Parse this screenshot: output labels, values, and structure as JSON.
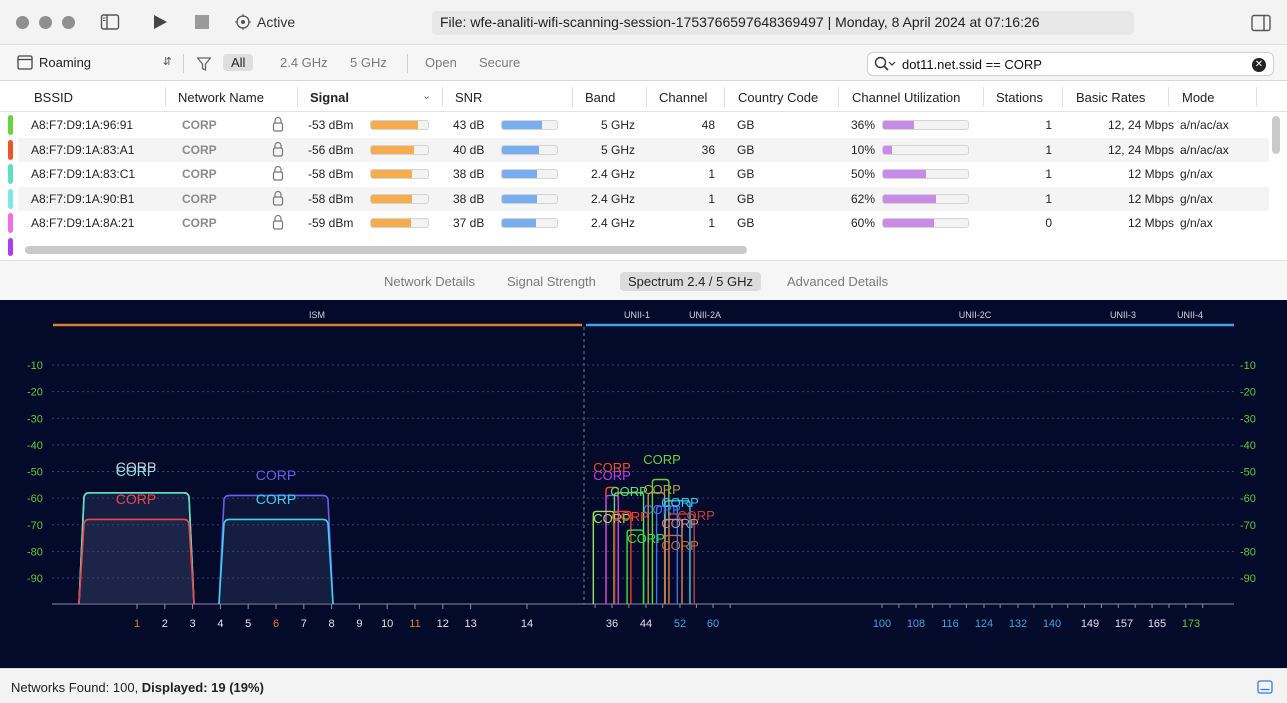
{
  "titlebar": {
    "active_label": "Active",
    "file_label": "File: wfe-analiti-wifi-scanning-session-1753766597648369497 | Monday, 8 April 2024 at 07:16:26"
  },
  "toolbar": {
    "mode_select": "Roaming",
    "filters": [
      "All",
      "2.4 GHz",
      "5 GHz",
      "Open",
      "Secure"
    ],
    "search_value": "dot11.net.ssid == CORP"
  },
  "table": {
    "headers": [
      "BSSID",
      "Network Name",
      "Signal",
      "SNR",
      "Band",
      "Channel",
      "Country Code",
      "Channel Utilization",
      "Stations",
      "Basic Rates",
      "Mode"
    ],
    "rows": [
      {
        "tag": "#6ad23a",
        "bssid": "A8:F7:D9:1A:96:91",
        "name": "CORP",
        "signal": "-53 dBm",
        "signal_frac": 0.82,
        "snr": "43 dB",
        "snr_frac": 0.72,
        "band": "5 GHz",
        "channel": "48",
        "country": "GB",
        "util": "36%",
        "util_frac": 0.36,
        "stations": "1",
        "rates": "12, 24 Mbps",
        "mode": "a/n/ac/ax"
      },
      {
        "tag": "#f0522a",
        "bssid": "A8:F7:D9:1A:83:A1",
        "name": "CORP",
        "signal": "-56 dBm",
        "signal_frac": 0.75,
        "snr": "40 dB",
        "snr_frac": 0.68,
        "band": "5 GHz",
        "channel": "36",
        "country": "GB",
        "util": "10%",
        "util_frac": 0.1,
        "stations": "1",
        "rates": "12, 24 Mbps",
        "mode": "a/n/ac/ax"
      },
      {
        "tag": "#5de0c0",
        "bssid": "A8:F7:D9:1A:83:C1",
        "name": "CORP",
        "signal": "-58 dBm",
        "signal_frac": 0.72,
        "snr": "38 dB",
        "snr_frac": 0.64,
        "band": "2.4 GHz",
        "channel": "1",
        "country": "GB",
        "util": "50%",
        "util_frac": 0.5,
        "stations": "1",
        "rates": "12 Mbps",
        "mode": "g/n/ax"
      },
      {
        "tag": "#7de8e0",
        "bssid": "A8:F7:D9:1A:90:B1",
        "name": "CORP",
        "signal": "-58 dBm",
        "signal_frac": 0.72,
        "snr": "38 dB",
        "snr_frac": 0.64,
        "band": "2.4 GHz",
        "channel": "1",
        "country": "GB",
        "util": "62%",
        "util_frac": 0.62,
        "stations": "1",
        "rates": "12 Mbps",
        "mode": "g/n/ax"
      },
      {
        "tag": "#ee6fe6",
        "bssid": "A8:F7:D9:1A:8A:21",
        "name": "CORP",
        "signal": "-59 dBm",
        "signal_frac": 0.7,
        "snr": "37 dB",
        "snr_frac": 0.62,
        "band": "2.4 GHz",
        "channel": "1",
        "country": "GB",
        "util": "60%",
        "util_frac": 0.6,
        "stations": "0",
        "rates": "12 Mbps",
        "mode": "g/n/ax"
      }
    ]
  },
  "tabs": [
    "Network Details",
    "Signal Strength",
    "Spectrum 2.4 / 5 GHz",
    "Advanced Details"
  ],
  "selected_tab": "Spectrum 2.4 / 5 GHz",
  "colors": {
    "signal": "#f7ad4e",
    "snr": "#78aef0",
    "util": "#c88be8",
    "ism": "#e07e2c",
    "unii": "#3aa6e3",
    "grid_label": "#5ecb3a"
  },
  "chart_data": {
    "type": "area",
    "y_axis": {
      "ticks": [
        -10,
        -20,
        -30,
        -40,
        -50,
        -60,
        -70,
        -80,
        -90
      ],
      "ylim": [
        -100,
        0
      ]
    },
    "band_labels": [
      "ISM",
      "UNII-1",
      "UNII-2A",
      "UNII-2C",
      "UNII-3",
      "UNII-4"
    ],
    "x_ticks_24": [
      "1",
      "2",
      "3",
      "4",
      "5",
      "6",
      "7",
      "8",
      "9",
      "10",
      "11",
      "12",
      "13",
      "14"
    ],
    "x_ticks_24_highlight": [
      "1",
      "6",
      "11"
    ],
    "x_ticks_5": [
      "36",
      "44",
      "52",
      "60",
      "100",
      "108",
      "116",
      "124",
      "132",
      "140",
      "149",
      "157",
      "165",
      "173"
    ],
    "series_24": [
      {
        "label": "CORP",
        "center": 3,
        "dbm": -58,
        "color": "#7de8e0"
      },
      {
        "label": "CORP",
        "center": 3,
        "dbm": -58,
        "color": "#5de0c0"
      },
      {
        "label": "CORP",
        "center": 3,
        "dbm": -68,
        "color": "#f0444a"
      },
      {
        "label": "CORP",
        "center": 6,
        "dbm": -59,
        "color": "#6a5cf0"
      },
      {
        "label": "CORP",
        "center": 6,
        "dbm": -68,
        "color": "#3cd2f0"
      }
    ],
    "series_5": [
      {
        "label": "CORP",
        "ch_from": 36,
        "ch_to": 37,
        "dbm": -56,
        "color": "#f0522a"
      },
      {
        "label": "CORP",
        "ch_from": 36,
        "ch_to": 37,
        "dbm": -59,
        "color": "#c040e8"
      },
      {
        "label": "CORP",
        "ch_from": 38,
        "ch_to": 43,
        "dbm": -58,
        "color": "#60e070"
      },
      {
        "label": "CORP",
        "ch_from": 47,
        "ch_to": 49,
        "dbm": -53,
        "color": "#6ad23a"
      },
      {
        "label": "CORP",
        "ch_from": 46,
        "ch_to": 48,
        "dbm": -58,
        "color": "#b0a040"
      },
      {
        "label": "CORP",
        "ch_from": 48,
        "ch_to": 51,
        "dbm": -63,
        "color": "#4070f0"
      },
      {
        "label": "CORP",
        "ch_from": 50,
        "ch_to": 54,
        "dbm": -61,
        "color": "#3cc8f0"
      },
      {
        "label": "CORP",
        "ch_from": 33,
        "ch_to": 36,
        "dbm": -65,
        "color": "#a0e060"
      },
      {
        "label": "CORP",
        "ch_from": 38,
        "ch_to": 40,
        "dbm": -65,
        "color": "#f04030"
      },
      {
        "label": "CORP",
        "ch_from": 51,
        "ch_to": 55,
        "dbm": -66,
        "color": "#c04040"
      },
      {
        "label": "CORP",
        "ch_from": 50,
        "ch_to": 52,
        "dbm": -68,
        "color": "#c09090"
      },
      {
        "label": "CORP",
        "ch_from": 41,
        "ch_to": 43,
        "dbm": -72,
        "color": "#40e040"
      },
      {
        "label": "CORP",
        "ch_from": 50,
        "ch_to": 52,
        "dbm": -74,
        "color": "#c07040"
      }
    ]
  },
  "status": {
    "networks_found_label": "Networks Found: 100, ",
    "displayed_label": "Displayed: 19 (19%)"
  }
}
